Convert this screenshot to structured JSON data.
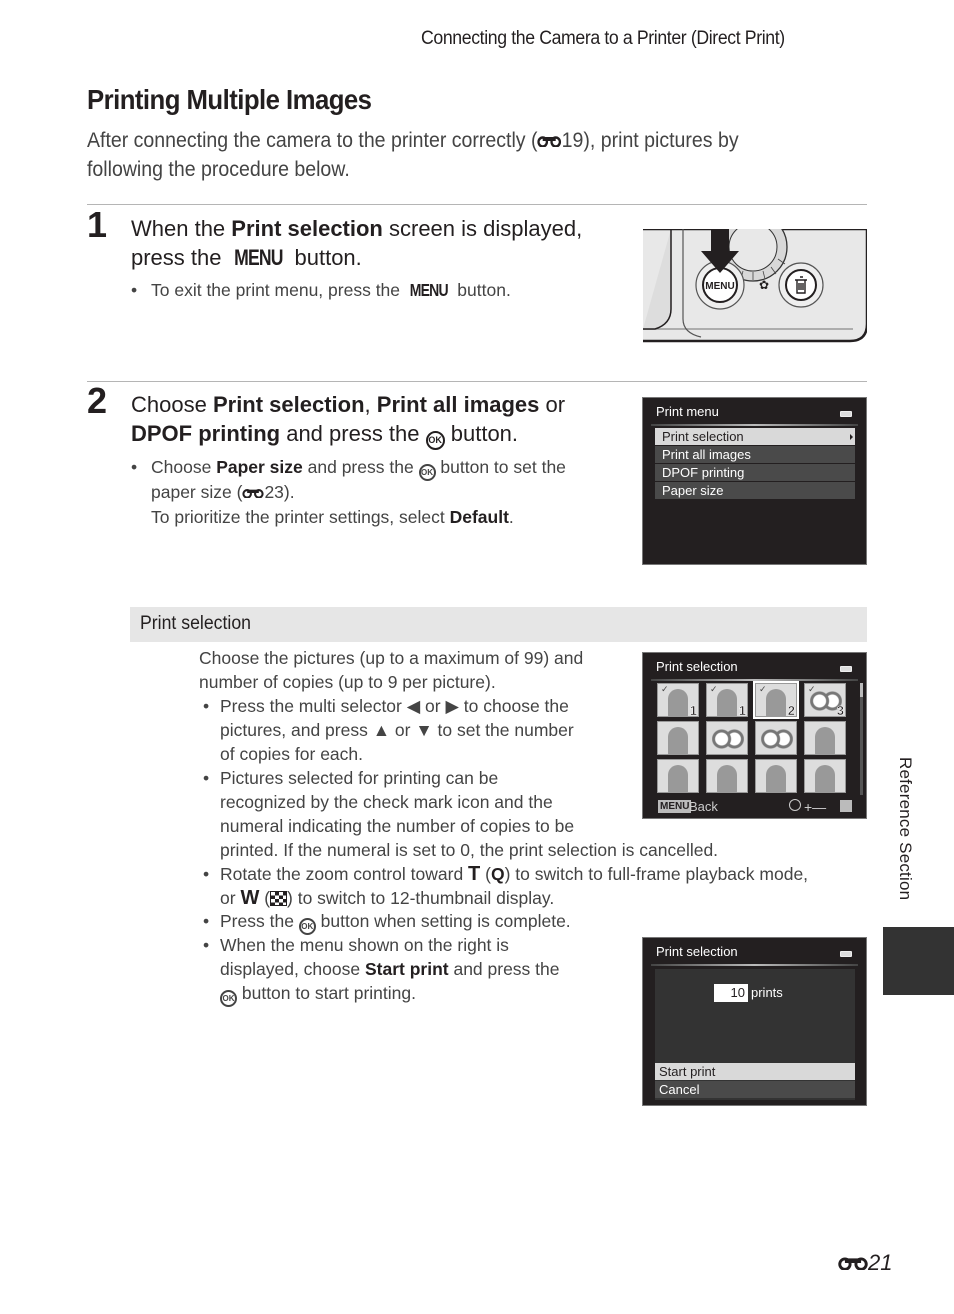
{
  "header": {
    "running_head": "Connecting the Camera to a Printer (Direct Print)"
  },
  "title": "Printing Multiple Images",
  "intro": {
    "part1": "After connecting the camera to the printer correctly (",
    "ref": "19",
    "part2": "), print pictures by following the procedure below."
  },
  "steps": [
    {
      "number": "1",
      "heading": {
        "pre": "When the ",
        "bold": "Print selection",
        "mid": " screen is displayed, press the ",
        "menu_word": "MENU",
        "post": " button."
      },
      "bullets": [
        {
          "pre": "To exit the print menu, press the ",
          "menu_word": "MENU",
          "post": " button."
        }
      ],
      "illustration": {
        "button_label": "MENU",
        "icons": [
          "arrow-down-icon",
          "macro-flower-icon",
          "trash-icon"
        ]
      }
    },
    {
      "number": "2",
      "heading": {
        "pre": "Choose ",
        "b1": "Print selection",
        "sep1": ", ",
        "b2": "Print all images",
        "sep2": " or",
        "b3": "DPOF printing",
        "mid": " and press the ",
        "ok": "OK",
        "post": " button."
      },
      "bullets": [
        {
          "pre": "Choose ",
          "bold": "Paper size",
          "mid": " and press the ",
          "ok": "OK",
          "post": " button to set the",
          "line2_pre": "paper size (",
          "line2_ref": "23",
          "line2_post": ").",
          "line3_pre": "To prioritize the printer settings, select ",
          "line3_bold": "Default",
          "line3_post": "."
        }
      ],
      "screen": {
        "title": "Print menu",
        "items": [
          "Print selection",
          "Print all images",
          "DPOF printing",
          "Paper size"
        ],
        "selected_index": 0
      }
    }
  ],
  "print_selection": {
    "section_title": "Print selection",
    "intro_lines": [
      "Choose the pictures (up to a maximum of 99) and",
      "number of copies (up to 9 per picture)."
    ],
    "bullets": [
      {
        "lines": [
          "Press the multi selector ◀ or ▶ to choose the",
          "pictures, and press ▲ or ▼ to set the number",
          "of copies for each."
        ]
      },
      {
        "lines": [
          "Pictures selected for printing can be",
          "recognized by the check mark icon and the",
          "numeral indicating the number of copies to be"
        ],
        "wide_line": "printed. If the numeral is set to 0, the print selection is cancelled."
      },
      {
        "pre": "Rotate the zoom control toward ",
        "t": "T",
        "t_icon": "Q",
        "mid": " to switch to full-frame playback mode,",
        "line2_pre": "or ",
        "w": "W",
        "line2_post": " to switch to 12-thumbnail display."
      },
      {
        "pre": "Press the ",
        "ok": "OK",
        "post": " button when setting is complete."
      },
      {
        "line1": "When the menu shown on the right is",
        "line2_pre": "displayed, choose ",
        "line2_bold": "Start print",
        "line2_post": " and press the",
        "ok": "OK",
        "line3_post": " button to start printing."
      }
    ],
    "thumbnail_screen": {
      "title": "Print selection",
      "footer_menu": "MENU",
      "footer_back": "Back",
      "footer_hint": "+—",
      "thumbnails": [
        {
          "type": "portrait",
          "checked": true,
          "count": "1"
        },
        {
          "type": "figure",
          "checked": true,
          "count": "1"
        },
        {
          "type": "family",
          "checked": true,
          "count": "2",
          "current": true
        },
        {
          "type": "flowers",
          "checked": true,
          "count": "3"
        },
        {
          "type": "portrait",
          "checked": false,
          "count": ""
        },
        {
          "type": "flowers",
          "checked": false,
          "count": ""
        },
        {
          "type": "flowers",
          "checked": false,
          "count": ""
        },
        {
          "type": "figure",
          "checked": false,
          "count": ""
        },
        {
          "type": "figure",
          "checked": false,
          "count": ""
        },
        {
          "type": "family",
          "checked": false,
          "count": ""
        },
        {
          "type": "portrait",
          "checked": false,
          "count": ""
        },
        {
          "type": "portrait",
          "checked": false,
          "count": ""
        }
      ]
    },
    "confirm_screen": {
      "title": "Print selection",
      "count": "10",
      "count_label": "prints",
      "items": [
        "Start print",
        "Cancel"
      ],
      "selected_index": 0
    }
  },
  "side_tab": {
    "label": "Reference Section"
  },
  "footer": {
    "page_number": "21"
  }
}
